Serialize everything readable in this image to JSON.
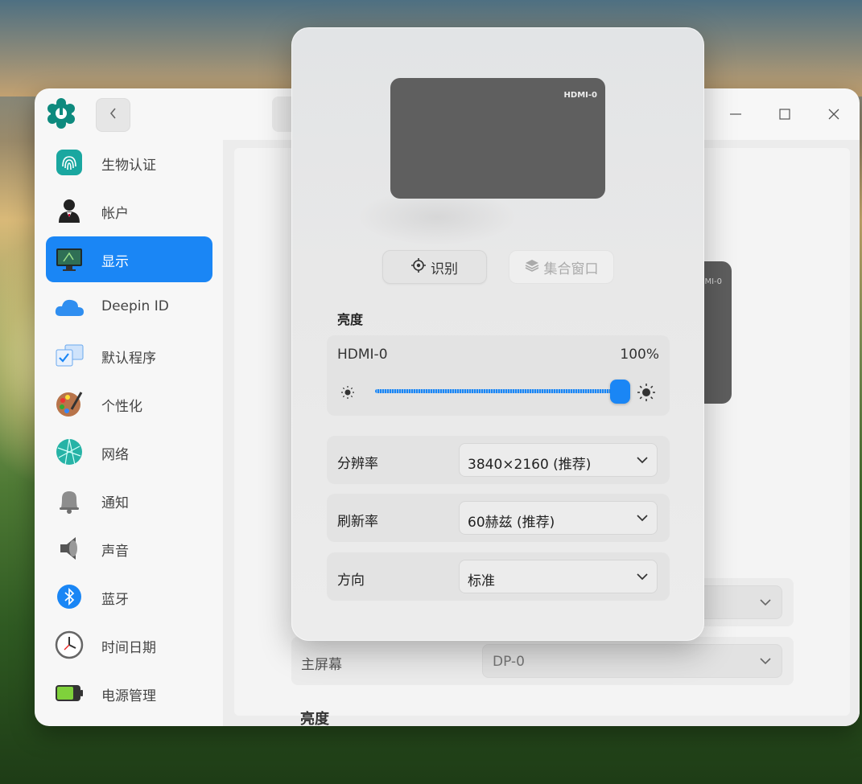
{
  "sidebar": {
    "items": [
      {
        "label": "生物认证",
        "icon": "fingerprint-icon"
      },
      {
        "label": "帐户",
        "icon": "account-icon"
      },
      {
        "label": "显示",
        "icon": "display-icon"
      },
      {
        "label": "Deepin ID",
        "icon": "cloud-icon"
      },
      {
        "label": "默认程序",
        "icon": "default-apps-icon"
      },
      {
        "label": "个性化",
        "icon": "palette-icon"
      },
      {
        "label": "网络",
        "icon": "network-icon"
      },
      {
        "label": "通知",
        "icon": "bell-icon"
      },
      {
        "label": "声音",
        "icon": "speaker-icon"
      },
      {
        "label": "蓝牙",
        "icon": "bluetooth-icon"
      },
      {
        "label": "时间日期",
        "icon": "clock-icon"
      },
      {
        "label": "电源管理",
        "icon": "battery-icon"
      }
    ],
    "active_index": 2
  },
  "background": {
    "monitor_label": "HDMI-0",
    "primary_screen_label": "主屏幕",
    "primary_screen_value": "DP-0",
    "brightness_title": "亮度"
  },
  "popup": {
    "monitor_label": "HDMI-0",
    "identify_label": "识别",
    "merge_label": "集合窗口",
    "brightness_title": "亮度",
    "brightness": {
      "monitor": "HDMI-0",
      "value_text": "100%",
      "value": 1.0
    },
    "resolution": {
      "label": "分辨率",
      "value": "3840×2160 (推荐)"
    },
    "refresh_rate": {
      "label": "刷新率",
      "value": "60赫兹 (推荐)"
    },
    "orientation": {
      "label": "方向",
      "value": "标准"
    }
  },
  "colors": {
    "accent": "#1a86f5"
  }
}
